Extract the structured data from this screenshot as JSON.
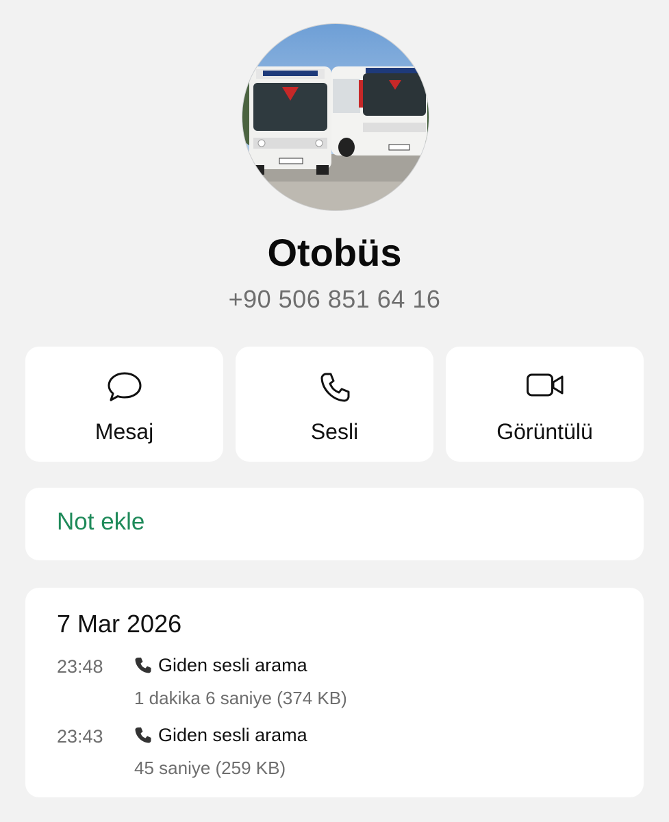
{
  "contact": {
    "name": "Otobüs",
    "phone": "+90 506 851 64 16"
  },
  "actions": {
    "message_label": "Mesaj",
    "voice_label": "Sesli",
    "video_label": "Görüntülü"
  },
  "note": {
    "label": "Not ekle"
  },
  "colors": {
    "accent_green": "#1f8a5a",
    "background": "#f2f2f2"
  },
  "history": {
    "date": "7 Mar 2026",
    "calls": [
      {
        "time": "23:48",
        "type": "Giden sesli arama",
        "detail": "1 dakika 6 saniye (374 KB)"
      },
      {
        "time": "23:43",
        "type": "Giden sesli arama",
        "detail": "45 saniye (259 KB)"
      }
    ]
  },
  "icons": [
    "speech-bubble-icon",
    "phone-icon",
    "video-camera-icon",
    "outgoing-call-icon"
  ]
}
